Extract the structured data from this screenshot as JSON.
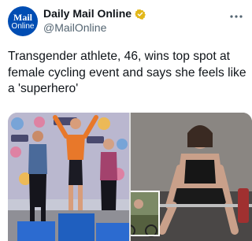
{
  "account": {
    "avatar_line1": "Mail",
    "avatar_line2": "Online",
    "display_name": "Daily Mail Online",
    "verified_icon": "gold-verified-badge-icon",
    "handle": "@MailOnline",
    "more_icon": "more-options-icon"
  },
  "tweet": {
    "text": "Transgender athlete, 46, wins top spot at female cycling event and says she feels like a 'superhero'"
  },
  "media": {
    "left_image": "podium-photo-image",
    "right_image": "weightlifting-photo-image"
  },
  "colors": {
    "avatar_bg": "#004db3",
    "verified_gold": "#e2b719",
    "text_primary": "#0f1419",
    "text_secondary": "#536471"
  }
}
